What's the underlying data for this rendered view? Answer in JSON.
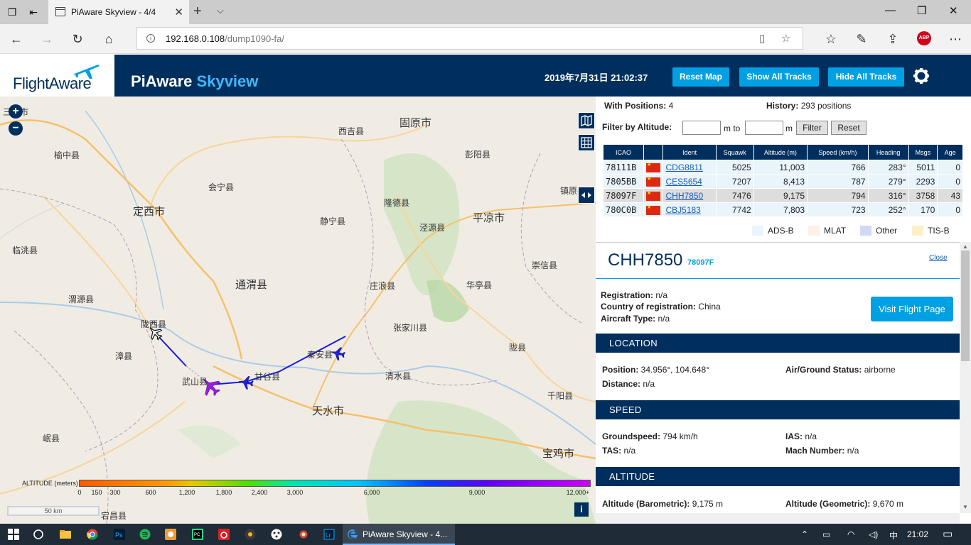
{
  "browser": {
    "tab_title": "PiAware Skyview - 4/4",
    "url_host": "192.168.0.108",
    "url_path": "/dump1090-fa/",
    "abp_label": "ABP"
  },
  "header": {
    "logo_text": "FlightAware",
    "title_main": "PiAware",
    "title_accent": "Skyview",
    "clock": "2019年7月31日 21:02:37",
    "buttons": {
      "reset_map": "Reset Map",
      "show_tracks": "Show All Tracks",
      "hide_tracks": "Hide All Tracks"
    }
  },
  "map": {
    "places": [
      "三河市",
      "西吉县",
      "固原市",
      "榆中县",
      "彭阳县",
      "会宁县",
      "镇原县",
      "定西市",
      "隆德县",
      "静宁县",
      "平凉市",
      "泾源县",
      "临洮县",
      "通渭县",
      "崇信县",
      "庄浪县",
      "华亭县",
      "渭源县",
      "陇西县",
      "张家川县",
      "秦安县",
      "陇县",
      "漳县",
      "武山县",
      "甘谷县",
      "清水县",
      "千阳县",
      "天水市",
      "岷县",
      "宝鸡市",
      "宕昌县"
    ],
    "altitude_legend": {
      "label": "ALTITUDE (meters)",
      "ticks": [
        "0",
        "150",
        "300",
        "600",
        "1,200",
        "1,800",
        "2,400",
        "3,000",
        "6,000",
        "9,000",
        "12,000+"
      ]
    },
    "scale_label": "50 km",
    "info_label": "i"
  },
  "stats": {
    "with_positions_label": "With Positions:",
    "with_positions": "4",
    "history_label": "History:",
    "history": "293 positions"
  },
  "filter": {
    "label": "Filter by Altitude:",
    "from": "",
    "to_label": "m to",
    "to": "",
    "unit": "m",
    "filter_btn": "Filter",
    "reset_btn": "Reset"
  },
  "table": {
    "headers": [
      "ICAO",
      "",
      "Ident",
      "Squawk",
      "Altitude (m)",
      "Speed (km/h)",
      "Heading",
      "Msgs",
      "Age"
    ],
    "rows": [
      {
        "icao": "78111B",
        "ident": "CDG8811",
        "squawk": "5025",
        "altitude": "11,003",
        "speed": "766",
        "heading": "283°",
        "msgs": "5011",
        "age": "0"
      },
      {
        "icao": "7805BB",
        "ident": "CES5654",
        "squawk": "7207",
        "altitude": "8,413",
        "speed": "787",
        "heading": "279°",
        "msgs": "2293",
        "age": "0"
      },
      {
        "icao": "78097F",
        "ident": "CHH7850",
        "squawk": "7476",
        "altitude": "9,175",
        "speed": "794",
        "heading": "316°",
        "msgs": "3758",
        "age": "43"
      },
      {
        "icao": "780C0B",
        "ident": "CBJ5183",
        "squawk": "7742",
        "altitude": "7,803",
        "speed": "723",
        "heading": "252°",
        "msgs": "170",
        "age": "0"
      }
    ]
  },
  "legend": [
    {
      "label": "ADS-B",
      "color": "#e9f4fb"
    },
    {
      "label": "MLAT",
      "color": "#fdf0e6"
    },
    {
      "label": "Other",
      "color": "#d0d8f4"
    },
    {
      "label": "TIS-B",
      "color": "#fbf0c8"
    }
  ],
  "detail": {
    "callsign": "CHH7850",
    "hex": "78097F",
    "close": "Close",
    "registration_label": "Registration:",
    "registration": "n/a",
    "country_label": "Country of registration:",
    "country": "China",
    "type_label": "Aircraft Type:",
    "type": "n/a",
    "visit_btn": "Visit Flight Page",
    "location": {
      "title": "LOCATION",
      "position_label": "Position:",
      "position": "34.956°, 104.648°",
      "airground_label": "Air/Ground Status:",
      "airground": "airborne",
      "distance_label": "Distance:",
      "distance": "n/a"
    },
    "speed": {
      "title": "SPEED",
      "gs_label": "Groundspeed:",
      "gs": "794 km/h",
      "ias_label": "IAS:",
      "ias": "n/a",
      "tas_label": "TAS:",
      "tas": "n/a",
      "mach_label": "Mach Number:",
      "mach": "n/a"
    },
    "altitude": {
      "title": "ALTITUDE",
      "baro_label": "Altitude (Barometric):",
      "baro": "9,175 m",
      "geo_label": "Altitude (Geometric):",
      "geo": "9,670 m"
    }
  },
  "taskbar": {
    "active_label": "PiAware Skyview - 4...",
    "time": "21:02",
    "ime": "中"
  },
  "colors": {
    "brand": "#002f5d",
    "accent": "#00a0e2",
    "track": "#1a1adc",
    "selected_plane": "#9b1de0"
  }
}
